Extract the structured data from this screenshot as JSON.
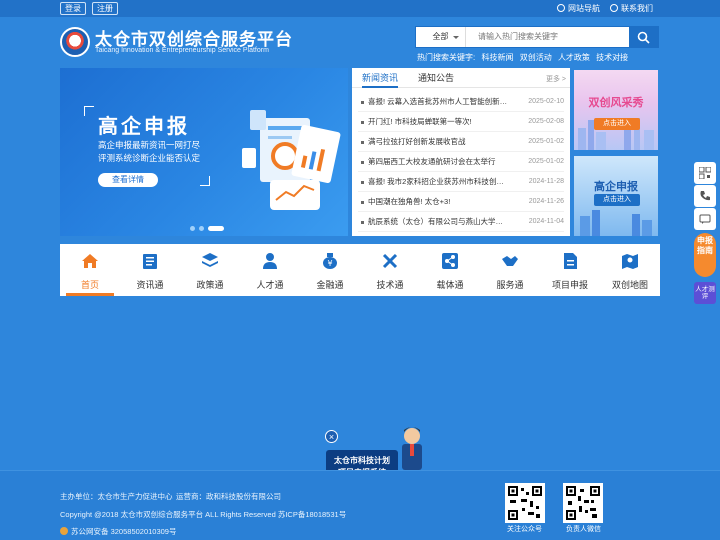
{
  "topbar": {
    "login_label": "登录",
    "register_label": "注册",
    "site_nav_label": "网站导航",
    "contact_label": "联系我们"
  },
  "header": {
    "title": "太仓市双创综合服务平台",
    "subtitle": "Taicang Innovation & Entrepreneurship Service Platform",
    "search_select": "全部",
    "search_placeholder": "请输入热门搜索关键字",
    "hot_label": "热门搜索关键字:",
    "hot_keywords": [
      "科技新闻",
      "双创活动",
      "人才政策",
      "技术对接"
    ]
  },
  "banner": {
    "title": "高企申报",
    "line1": "高企申报最新资讯一网打尽",
    "line2": "评测系统诊断企业能否认定",
    "button": "查看详情"
  },
  "news": {
    "tabs": [
      "新闻资讯",
      "通知公告"
    ],
    "more": "更多 >",
    "items": [
      {
        "title": "喜报! 云幕入选首批苏州市人工智能创新…",
        "date": "2025-02-10"
      },
      {
        "title": "开门红! 市科技局蝉联第一等次!",
        "date": "2025-02-08"
      },
      {
        "title": "满弓拉弦打好创新发展收官战",
        "date": "2025-01-02"
      },
      {
        "title": "第四届西工大校友通航研讨会在太举行",
        "date": "2025-01-02"
      },
      {
        "title": "喜报! 我市2家科招企业获苏州市科技创业…",
        "date": "2024-11-28"
      },
      {
        "title": "中国潮在独角兽! 太仓+3!",
        "date": "2024-11-26"
      },
      {
        "title": "航辰系统（太仓）有限公司与燕山大学签…",
        "date": "2024-11-04"
      }
    ]
  },
  "ads": {
    "ad1_title": "双创风采秀",
    "ad1_button": "点击进入",
    "ad2_title": "高企申报",
    "ad2_button": "点击进入"
  },
  "nav": {
    "items": [
      {
        "label": "首页",
        "icon": "home-icon"
      },
      {
        "label": "资讯通",
        "icon": "news-icon"
      },
      {
        "label": "政策通",
        "icon": "layers-icon"
      },
      {
        "label": "人才通",
        "icon": "person-icon"
      },
      {
        "label": "金融通",
        "icon": "money-icon"
      },
      {
        "label": "技术通",
        "icon": "tools-icon"
      },
      {
        "label": "载体通",
        "icon": "share-icon"
      },
      {
        "label": "服务通",
        "icon": "handshake-icon"
      },
      {
        "label": "项目申报",
        "icon": "document-icon"
      },
      {
        "label": "双创地图",
        "icon": "map-icon"
      }
    ],
    "active_index": 0
  },
  "sidebar": {
    "apply_label": "申报指南",
    "talent_label": "人才测评"
  },
  "float_ad": {
    "close": "×",
    "line1": "太仓市科技计划",
    "line2": "项目申报系统"
  },
  "footer": {
    "host": "主办单位：太仓市生产力促进中心",
    "operator": "运营商：政和科技股份有限公司",
    "copyright": "Copyright @2018 太仓市双创综合服务平台 ALL Rights Reserved 苏ICP备18018531号",
    "police": "苏公网安备 32058502010309号",
    "qr1_label": "关注公众号",
    "qr2_label": "负责人微信"
  },
  "colors": {
    "page_bg": "#2e86dc",
    "primary": "#1d6fc6",
    "accent": "#f07b25"
  }
}
